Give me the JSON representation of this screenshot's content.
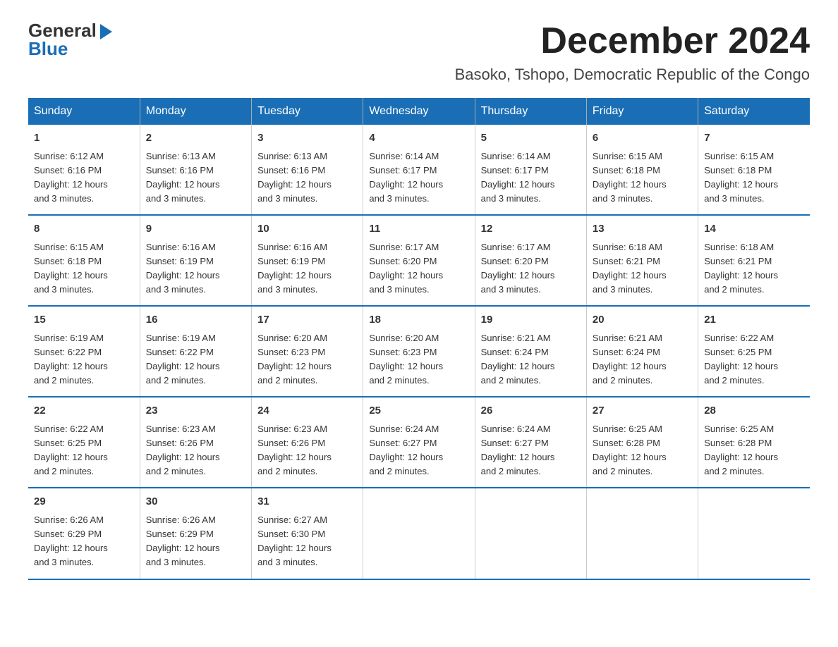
{
  "header": {
    "logo_general": "General",
    "logo_blue": "Blue",
    "main_title": "December 2024",
    "subtitle": "Basoko, Tshopo, Democratic Republic of the Congo"
  },
  "days_of_week": [
    "Sunday",
    "Monday",
    "Tuesday",
    "Wednesday",
    "Thursday",
    "Friday",
    "Saturday"
  ],
  "weeks": [
    [
      {
        "day": "1",
        "sunrise": "6:12 AM",
        "sunset": "6:16 PM",
        "daylight": "12 hours and 3 minutes."
      },
      {
        "day": "2",
        "sunrise": "6:13 AM",
        "sunset": "6:16 PM",
        "daylight": "12 hours and 3 minutes."
      },
      {
        "day": "3",
        "sunrise": "6:13 AM",
        "sunset": "6:16 PM",
        "daylight": "12 hours and 3 minutes."
      },
      {
        "day": "4",
        "sunrise": "6:14 AM",
        "sunset": "6:17 PM",
        "daylight": "12 hours and 3 minutes."
      },
      {
        "day": "5",
        "sunrise": "6:14 AM",
        "sunset": "6:17 PM",
        "daylight": "12 hours and 3 minutes."
      },
      {
        "day": "6",
        "sunrise": "6:15 AM",
        "sunset": "6:18 PM",
        "daylight": "12 hours and 3 minutes."
      },
      {
        "day": "7",
        "sunrise": "6:15 AM",
        "sunset": "6:18 PM",
        "daylight": "12 hours and 3 minutes."
      }
    ],
    [
      {
        "day": "8",
        "sunrise": "6:15 AM",
        "sunset": "6:18 PM",
        "daylight": "12 hours and 3 minutes."
      },
      {
        "day": "9",
        "sunrise": "6:16 AM",
        "sunset": "6:19 PM",
        "daylight": "12 hours and 3 minutes."
      },
      {
        "day": "10",
        "sunrise": "6:16 AM",
        "sunset": "6:19 PM",
        "daylight": "12 hours and 3 minutes."
      },
      {
        "day": "11",
        "sunrise": "6:17 AM",
        "sunset": "6:20 PM",
        "daylight": "12 hours and 3 minutes."
      },
      {
        "day": "12",
        "sunrise": "6:17 AM",
        "sunset": "6:20 PM",
        "daylight": "12 hours and 3 minutes."
      },
      {
        "day": "13",
        "sunrise": "6:18 AM",
        "sunset": "6:21 PM",
        "daylight": "12 hours and 3 minutes."
      },
      {
        "day": "14",
        "sunrise": "6:18 AM",
        "sunset": "6:21 PM",
        "daylight": "12 hours and 2 minutes."
      }
    ],
    [
      {
        "day": "15",
        "sunrise": "6:19 AM",
        "sunset": "6:22 PM",
        "daylight": "12 hours and 2 minutes."
      },
      {
        "day": "16",
        "sunrise": "6:19 AM",
        "sunset": "6:22 PM",
        "daylight": "12 hours and 2 minutes."
      },
      {
        "day": "17",
        "sunrise": "6:20 AM",
        "sunset": "6:23 PM",
        "daylight": "12 hours and 2 minutes."
      },
      {
        "day": "18",
        "sunrise": "6:20 AM",
        "sunset": "6:23 PM",
        "daylight": "12 hours and 2 minutes."
      },
      {
        "day": "19",
        "sunrise": "6:21 AM",
        "sunset": "6:24 PM",
        "daylight": "12 hours and 2 minutes."
      },
      {
        "day": "20",
        "sunrise": "6:21 AM",
        "sunset": "6:24 PM",
        "daylight": "12 hours and 2 minutes."
      },
      {
        "day": "21",
        "sunrise": "6:22 AM",
        "sunset": "6:25 PM",
        "daylight": "12 hours and 2 minutes."
      }
    ],
    [
      {
        "day": "22",
        "sunrise": "6:22 AM",
        "sunset": "6:25 PM",
        "daylight": "12 hours and 2 minutes."
      },
      {
        "day": "23",
        "sunrise": "6:23 AM",
        "sunset": "6:26 PM",
        "daylight": "12 hours and 2 minutes."
      },
      {
        "day": "24",
        "sunrise": "6:23 AM",
        "sunset": "6:26 PM",
        "daylight": "12 hours and 2 minutes."
      },
      {
        "day": "25",
        "sunrise": "6:24 AM",
        "sunset": "6:27 PM",
        "daylight": "12 hours and 2 minutes."
      },
      {
        "day": "26",
        "sunrise": "6:24 AM",
        "sunset": "6:27 PM",
        "daylight": "12 hours and 2 minutes."
      },
      {
        "day": "27",
        "sunrise": "6:25 AM",
        "sunset": "6:28 PM",
        "daylight": "12 hours and 2 minutes."
      },
      {
        "day": "28",
        "sunrise": "6:25 AM",
        "sunset": "6:28 PM",
        "daylight": "12 hours and 2 minutes."
      }
    ],
    [
      {
        "day": "29",
        "sunrise": "6:26 AM",
        "sunset": "6:29 PM",
        "daylight": "12 hours and 3 minutes."
      },
      {
        "day": "30",
        "sunrise": "6:26 AM",
        "sunset": "6:29 PM",
        "daylight": "12 hours and 3 minutes."
      },
      {
        "day": "31",
        "sunrise": "6:27 AM",
        "sunset": "6:30 PM",
        "daylight": "12 hours and 3 minutes."
      },
      null,
      null,
      null,
      null
    ]
  ],
  "labels": {
    "sunrise": "Sunrise:",
    "sunset": "Sunset:",
    "daylight": "Daylight:"
  }
}
